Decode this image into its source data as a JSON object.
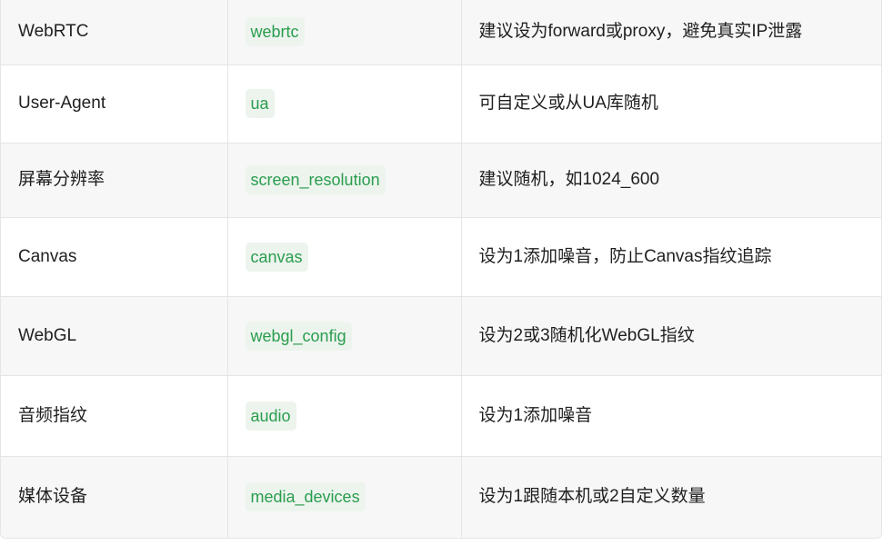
{
  "rows": [
    {
      "setting": "WebRTC",
      "param": "webrtc",
      "note": "建议设为forward或proxy，避免真实IP泄露"
    },
    {
      "setting": "User-Agent",
      "param": "ua",
      "note": "可自定义或从UA库随机"
    },
    {
      "setting": "屏幕分辨率",
      "param": "screen_resolution",
      "note": "建议随机，如1024_600"
    },
    {
      "setting": "Canvas",
      "param": "canvas",
      "note": "设为1添加噪音，防止Canvas指纹追踪"
    },
    {
      "setting": "WebGL",
      "param": "webgl_config",
      "note": "设为2或3随机化WebGL指纹"
    },
    {
      "setting": "音频指纹",
      "param": "audio",
      "note": "设为1添加噪音"
    },
    {
      "setting": "媒体设备",
      "param": "media_devices",
      "note": "设为1跟随本机或2自定义数量"
    }
  ],
  "colors": {
    "code_text": "#2a9d4e",
    "code_bg": "#edf4ee",
    "row_alt_bg": "#f7f7f7",
    "border": "#e5e5e5"
  }
}
